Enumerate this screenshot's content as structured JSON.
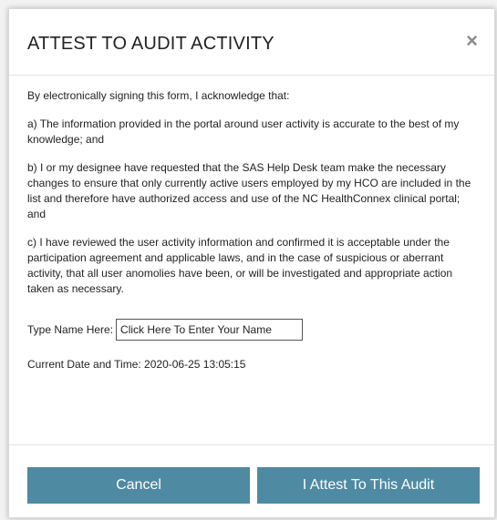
{
  "dialog": {
    "title": "ATTEST TO AUDIT ACTIVITY",
    "close_glyph": "×",
    "close_icon": "close-icon"
  },
  "content": {
    "intro": "By electronically signing this form, I acknowledge that:",
    "item_a": "a) The information provided in the portal around user activity is accurate to the best of my knowledge; and",
    "item_b": "b) I or my designee have requested that the SAS Help Desk team make the necessary changes to ensure that only currently active users employed by my HCO are included in the list and therefore have authorized access and use of the NC HealthConnex clinical portal; and",
    "item_c": "c) I have reviewed the user activity information and confirmed it is acceptable under the participation agreement and applicable laws, and in the case of suspicious or aberrant activity, that all user anomolies have been, or will be investigated and appropriate action taken as necessary."
  },
  "form": {
    "name_label": "Type Name Here:",
    "name_value": "",
    "name_placeholder": "Click Here To Enter Your Name",
    "datetime_text": "Current Date and Time: 2020-06-25 13:05:15"
  },
  "buttons": {
    "cancel_label": "Cancel",
    "attest_label": "I Attest To This Audit"
  },
  "colors": {
    "button_bg": "#4f8aa3",
    "button_text": "#ffffff"
  }
}
